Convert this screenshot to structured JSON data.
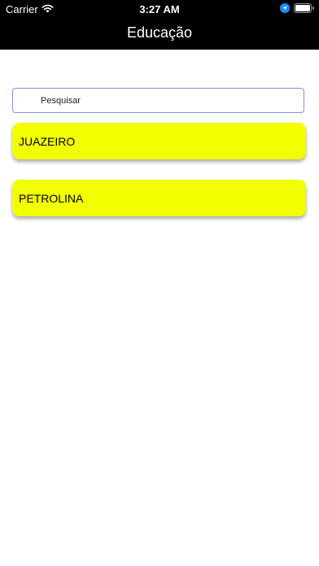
{
  "status_bar": {
    "carrier": "Carrier",
    "time": "3:27 AM",
    "icons": [
      "wifi-icon",
      "location-icon",
      "battery-icon"
    ]
  },
  "nav": {
    "title": "Educação"
  },
  "search": {
    "placeholder": "Pesquisar",
    "value": ""
  },
  "list": {
    "items": [
      {
        "label": "JUAZEIRO"
      },
      {
        "label": "PETROLINA"
      }
    ]
  },
  "colors": {
    "card": "#f2ff00",
    "nav_background": "#000000",
    "search_border": "#7f95d8",
    "location_accent": "#1a8cff"
  }
}
